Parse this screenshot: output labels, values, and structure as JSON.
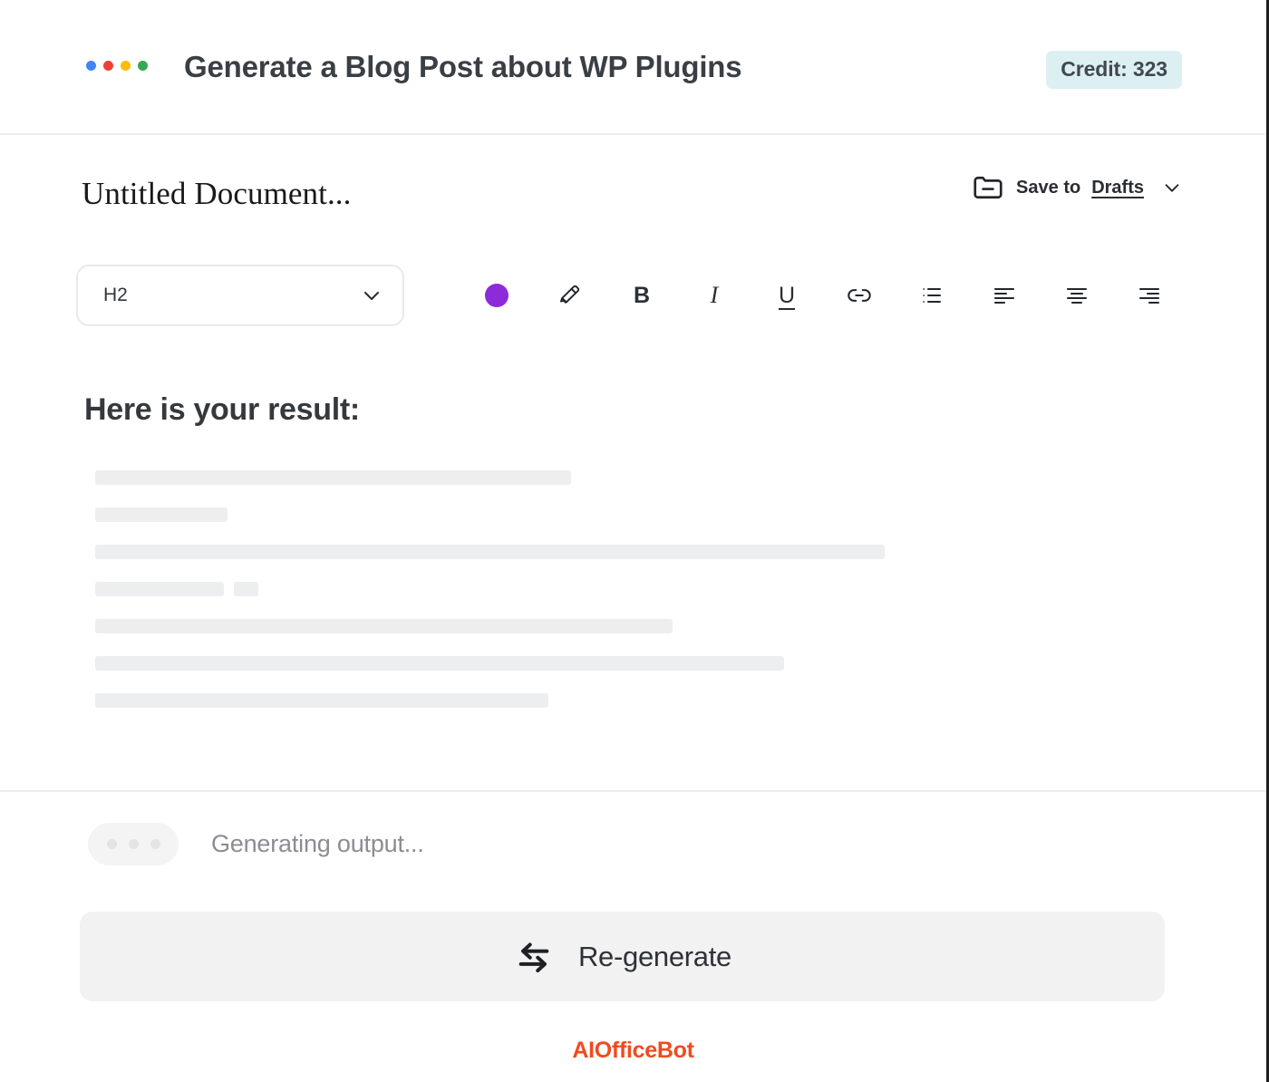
{
  "header": {
    "title": "Generate a Blog Post about WP Plugins",
    "credit_label": "Credit: 323",
    "credit_bg": "#dcf0f2",
    "brand_dots": [
      {
        "name": "dot-blue",
        "color": "#4285f4"
      },
      {
        "name": "dot-red",
        "color": "#ea4335"
      },
      {
        "name": "dot-yellow",
        "color": "#fbbc05"
      },
      {
        "name": "dot-green",
        "color": "#34a853"
      }
    ]
  },
  "document": {
    "title": "Untitled Document...",
    "save": {
      "icon": "folder-minus-icon",
      "label": "Save to",
      "target": "Drafts",
      "chevron": "chevron-down-icon"
    }
  },
  "toolbar": {
    "format_select": {
      "value": "H2",
      "chevron": "chevron-down-icon"
    },
    "items": [
      {
        "name": "text-color-swatch",
        "icon": "color-circle-icon",
        "label": "",
        "color": "#8b2bd9"
      },
      {
        "name": "highlighter-tool",
        "icon": "highlighter-icon",
        "label": ""
      },
      {
        "name": "bold-tool",
        "icon": "bold-icon",
        "label": "B"
      },
      {
        "name": "italic-tool",
        "icon": "italic-icon",
        "label": "I"
      },
      {
        "name": "underline-tool",
        "icon": "underline-icon",
        "label": "U"
      },
      {
        "name": "link-tool",
        "icon": "link-icon",
        "label": ""
      },
      {
        "name": "bullet-list-tool",
        "icon": "bulleted-list-icon",
        "label": ""
      },
      {
        "name": "align-left-tool",
        "icon": "align-left-icon",
        "label": ""
      },
      {
        "name": "align-center-tool",
        "icon": "align-center-icon",
        "label": ""
      },
      {
        "name": "align-right-tool",
        "icon": "align-right-icon",
        "label": ""
      }
    ]
  },
  "result": {
    "heading": "Here is your result:",
    "skeleton_color": "#eceef0",
    "skeleton_rows": [
      {
        "segments": [
          525
        ]
      },
      {
        "segments": [
          146
        ]
      },
      {
        "segments": [
          871
        ]
      },
      {
        "segments": [
          142,
          27
        ]
      },
      {
        "segments": [
          637
        ]
      },
      {
        "segments": [
          760
        ]
      },
      {
        "segments": [
          500
        ]
      }
    ]
  },
  "status": {
    "loader_icon": "three-dots-loading-icon",
    "loader_dots": 3,
    "text": "Generating output..."
  },
  "actions": {
    "regenerate": {
      "icon": "swap-arrows-icon",
      "label": "Re-generate"
    }
  },
  "footer": {
    "watermark": "AIOfficeBot",
    "watermark_color": "#f04b1e"
  }
}
